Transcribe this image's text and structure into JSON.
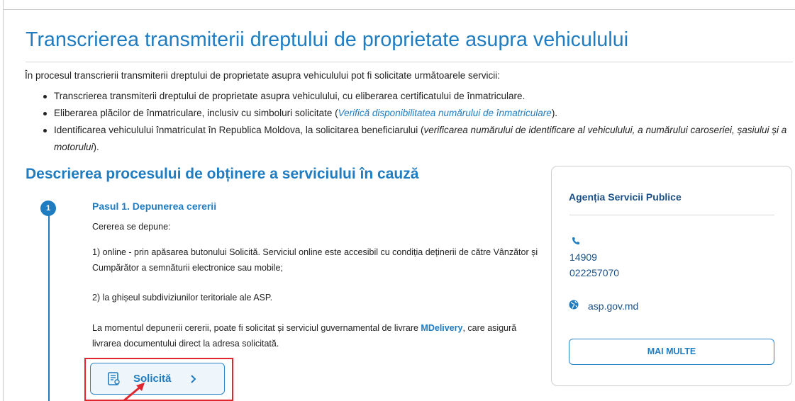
{
  "page": {
    "title": "Transcrierea transmiterii dreptului de proprietate asupra vehiculului",
    "intro": "În procesul transcrierii transmiterii dreptului de proprietate asupra vehiculului pot fi solicitate următoarele servicii:",
    "bullets": {
      "b1": "Transcrierea transmiterii dreptului de proprietate asupra vehiculului, cu eliberarea certificatului de înmatriculare.",
      "b2_pre": "Eliberarea plăcilor de înmatriculare, inclusiv cu simboluri solicitate (",
      "b2_link": "Verifică disponibilitatea numărului de înmatriculare",
      "b2_post": ").",
      "b3_pre": "Identificarea vehiculului înmatriculat în Republica Moldova, la solicitarea beneficiarului (",
      "b3_italic": "verificarea numărului de identificare al vehiculului, a numărului caroseriei, șasiului și a motorului",
      "b3_post": ")."
    },
    "subtitle": "Descrierea procesului de obținere a serviciului în cauză"
  },
  "step": {
    "number": "1",
    "title": "Pasul 1. Depunerea cererii",
    "p1": "Cererea se depune:",
    "p2": "1) online - prin apăsarea butonului Solicită. Serviciul online este accesibil cu condiția deținerii de către Vânzător și Cumpărător a semnăturii electronice sau mobile;",
    "p3": "2) la ghișeul subdiviziunilor teritoriale ale ASP.",
    "p4_pre": "La momentul depunerii cererii, poate fi solicitat și serviciul guvernamental de livrare ",
    "p4_bold": "MDelivery",
    "p4_post": ", care asigură livrarea documentului direct la adresa solicitată.",
    "button_label": "Solicită"
  },
  "card": {
    "title": "Agenția Servicii Publice",
    "phone1": "14909",
    "phone2": "022257070",
    "website": "asp.gov.md",
    "more_label": "MAI MULTE"
  },
  "colors": {
    "accent": "#1f7cc1",
    "dark_blue": "#1a4f86",
    "highlight": "#e0262e"
  },
  "icons": [
    "phone-icon",
    "globe-icon",
    "document-icon",
    "chevron-right-icon",
    "red-arrow"
  ]
}
